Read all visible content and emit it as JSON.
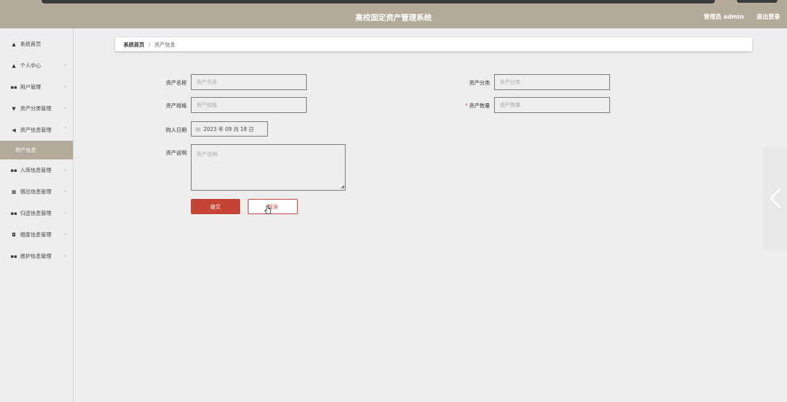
{
  "header": {
    "title": "高校固定资产管理系统",
    "user": "管理员 admin",
    "logout": "退出登录"
  },
  "sidebar": {
    "items": [
      {
        "label": "系统首页",
        "icon": "home-icon",
        "glyph": "▲"
      },
      {
        "label": "个人中心",
        "icon": "user-icon",
        "glyph": "▲"
      },
      {
        "label": "用户管理",
        "icon": "grid-icon",
        "glyph": "▪▪"
      },
      {
        "label": "资产分类管理",
        "icon": "filter-icon",
        "glyph": "▼"
      },
      {
        "label": "资产信息管理",
        "icon": "send-icon",
        "glyph": "◀"
      },
      {
        "label": "入库信息管理",
        "icon": "grid-icon",
        "glyph": "▪▪"
      },
      {
        "label": "借出信息管理",
        "icon": "grid-icon",
        "glyph": "▦"
      },
      {
        "label": "归还信息管理",
        "icon": "grid-icon",
        "glyph": "▪▪"
      },
      {
        "label": "报废信息管理",
        "icon": "trash-icon",
        "glyph": "◘"
      },
      {
        "label": "维护信息管理",
        "icon": "grid-icon",
        "glyph": "▪▪"
      }
    ],
    "sub_item": "资产信息"
  },
  "breadcrumb": {
    "home": "系统首页",
    "separator": "/",
    "current": "资产信息"
  },
  "form": {
    "name_label": "资产名称",
    "name_placeholder": "资产名称",
    "category_label": "资产分类",
    "category_placeholder": "资产分类",
    "spec_label": "资产规格",
    "spec_placeholder": "资产规格",
    "quantity_label": "资产数量",
    "quantity_placeholder": "资产数量",
    "quantity_required": "*",
    "date_label": "购入日期",
    "date_value": "2023 年 09 月 18 日",
    "desc_label": "资产说明",
    "desc_placeholder": "资产说明",
    "submit": "提交",
    "cancel": "取消"
  },
  "colors": {
    "header": "#b3aa99",
    "submit": "#c54332",
    "background": "#eeeeee"
  }
}
